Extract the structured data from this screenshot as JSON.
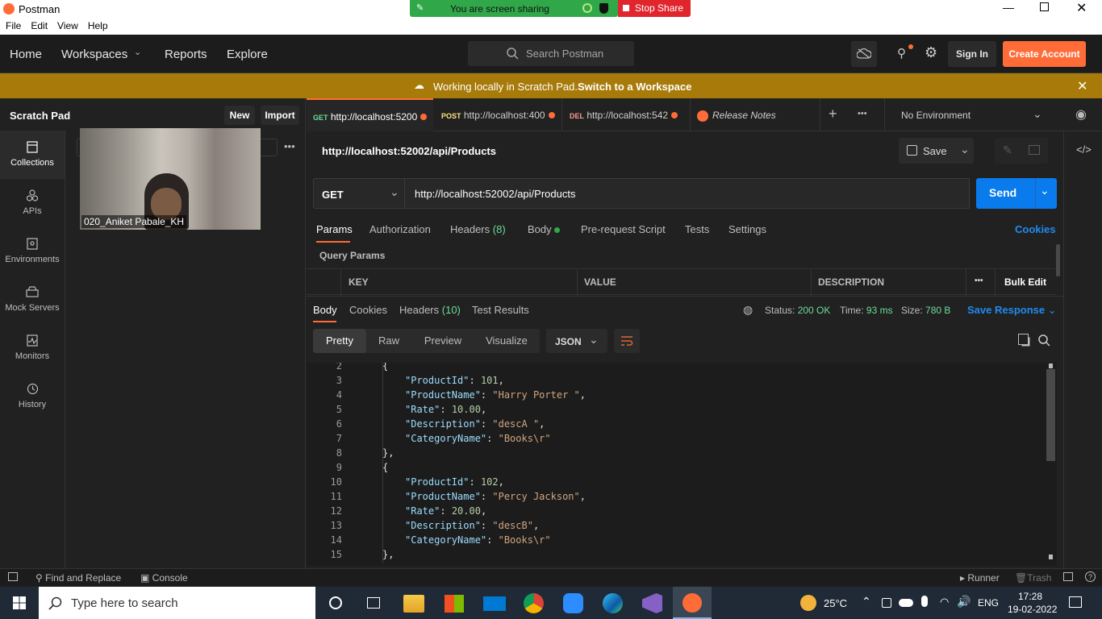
{
  "window": {
    "title": "Postman",
    "menu": [
      "File",
      "Edit",
      "View",
      "Help"
    ],
    "sharing_text": "You are screen sharing",
    "stop_share": "Stop Share"
  },
  "header": {
    "nav": [
      "Home",
      "Workspaces",
      "Reports",
      "Explore"
    ],
    "search_placeholder": "Search Postman",
    "sign_in": "Sign In",
    "create_account": "Create Account"
  },
  "banner": {
    "text": "Working locally in Scratch Pad.",
    "link": "Switch to a Workspace"
  },
  "sidebar": {
    "title": "Scratch Pad",
    "new_label": "New",
    "import_label": "Import",
    "items": [
      {
        "label": "Collections",
        "icon": "collections-icon"
      },
      {
        "label": "APIs",
        "icon": "apis-icon"
      },
      {
        "label": "Environments",
        "icon": "environments-icon"
      },
      {
        "label": "Mock Servers",
        "icon": "mock-servers-icon"
      },
      {
        "label": "Monitors",
        "icon": "monitors-icon"
      },
      {
        "label": "History",
        "icon": "history-icon"
      }
    ],
    "video_name": "020_Aniket Pabale_KH"
  },
  "tabs": [
    {
      "method": "GET",
      "url": "http://localhost:5200",
      "method_color": "#6bdd9a"
    },
    {
      "method": "POST",
      "url": "http://localhost:400",
      "method_color": "#ffe47e"
    },
    {
      "method": "DEL",
      "url": "http://localhost:542",
      "method_color": "#f79a8e"
    },
    {
      "method": "",
      "url": "Release Notes",
      "method_color": ""
    }
  ],
  "environment": "No Environment",
  "request": {
    "title": "http://localhost:52002/api/Products",
    "save": "Save",
    "method": "GET",
    "url": "http://localhost:52002/api/Products",
    "send": "Send",
    "tabs": [
      "Params",
      "Authorization",
      "Headers",
      "(8)",
      "Body",
      "Pre-request Script",
      "Tests",
      "Settings"
    ],
    "cookies": "Cookies",
    "query_params": "Query Params",
    "columns": [
      "KEY",
      "VALUE",
      "DESCRIPTION"
    ],
    "bulk_edit": "Bulk Edit"
  },
  "response": {
    "tabs": [
      "Body",
      "Cookies",
      "Headers",
      "(10)",
      "Test Results"
    ],
    "status_label": "Status:",
    "status": "200 OK",
    "time_label": "Time:",
    "time": "93 ms",
    "size_label": "Size:",
    "size": "780 B",
    "save_response": "Save Response",
    "views": [
      "Pretty",
      "Raw",
      "Preview",
      "Visualize"
    ],
    "format": "JSON",
    "lines": [
      {
        "n": "2",
        "t": "{"
      },
      {
        "n": "3",
        "k": "\"ProductId\"",
        "v": "101",
        "type": "n"
      },
      {
        "n": "4",
        "k": "\"ProductName\"",
        "v": "\"Harry Porter \"",
        "type": "s"
      },
      {
        "n": "5",
        "k": "\"Rate\"",
        "v": "10.00",
        "type": "n"
      },
      {
        "n": "6",
        "k": "\"Description\"",
        "v": "\"descA \"",
        "type": "s"
      },
      {
        "n": "7",
        "k": "\"CategoryName\"",
        "v": "\"Books\\r\"",
        "type": "s",
        "last": true
      },
      {
        "n": "8",
        "t": "},"
      },
      {
        "n": "9",
        "t": "{"
      },
      {
        "n": "10",
        "k": "\"ProductId\"",
        "v": "102",
        "type": "n"
      },
      {
        "n": "11",
        "k": "\"ProductName\"",
        "v": "\"Percy Jackson\"",
        "type": "s"
      },
      {
        "n": "12",
        "k": "\"Rate\"",
        "v": "20.00",
        "type": "n"
      },
      {
        "n": "13",
        "k": "\"Description\"",
        "v": "\"descB\"",
        "type": "s"
      },
      {
        "n": "14",
        "k": "\"CategoryName\"",
        "v": "\"Books\\r\"",
        "type": "s",
        "last": true
      },
      {
        "n": "15",
        "t": "},"
      }
    ]
  },
  "statusbar": {
    "find_replace": "Find and Replace",
    "console": "Console",
    "runner": "Runner",
    "trash": "Trash"
  },
  "taskbar": {
    "search_placeholder": "Type here to search",
    "weather": "25°C",
    "lang": "ENG",
    "time": "17:28",
    "date": "19-02-2022"
  }
}
